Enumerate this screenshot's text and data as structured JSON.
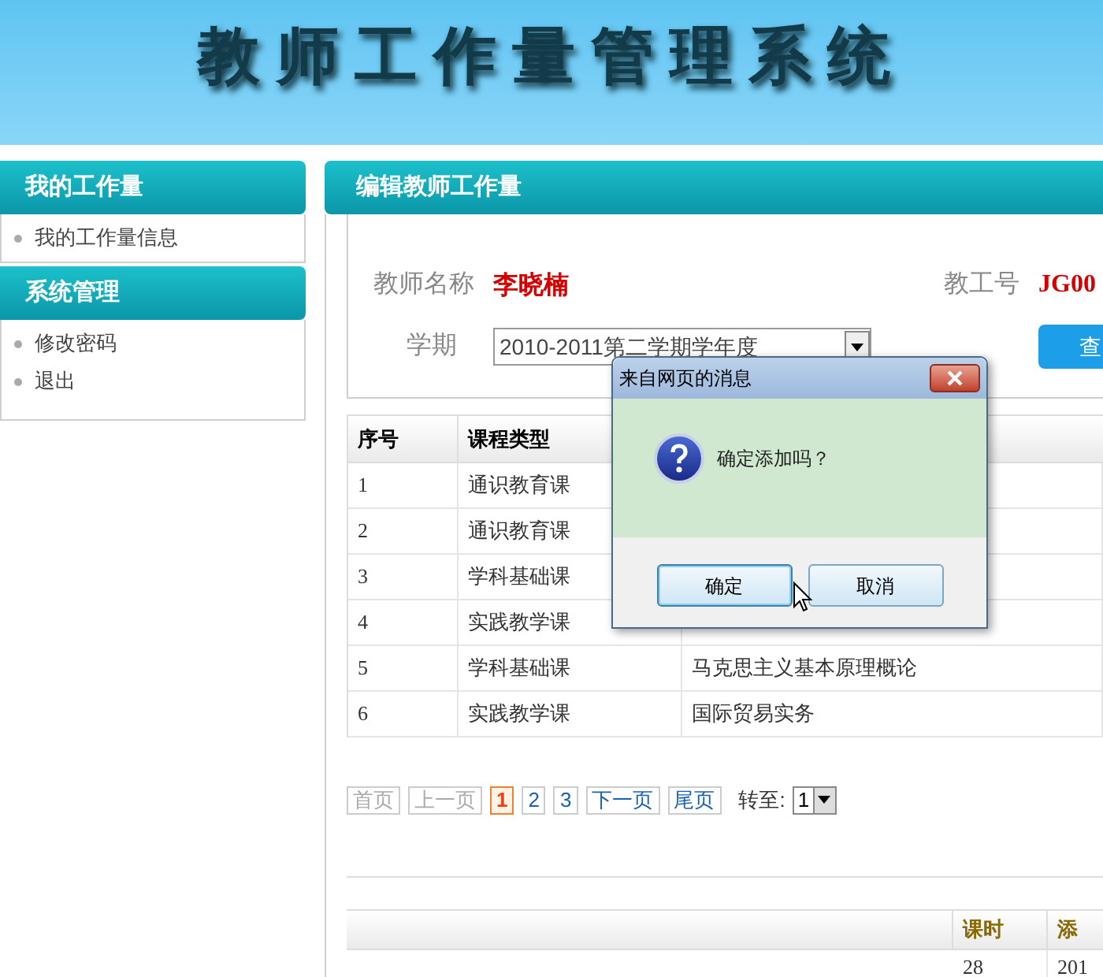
{
  "banner": {
    "title": "教师工作量管理系统"
  },
  "sidebar": [
    {
      "title": "我的工作量",
      "items": [
        {
          "label": "我的工作量信息"
        }
      ]
    },
    {
      "title": "系统管理",
      "items": [
        {
          "label": "修改密码"
        },
        {
          "label": "退出"
        }
      ]
    }
  ],
  "main": {
    "title": "编辑教师工作量",
    "form": {
      "teacher_label": "教师名称",
      "teacher_value": "李晓楠",
      "id_label": "教工号",
      "id_value": "JG00",
      "term_label": "学期",
      "term_value": "2010-2011第二学期学年度",
      "query_button": "查"
    },
    "table": {
      "columns": [
        "序号",
        "课程类型"
      ],
      "rows": [
        [
          "1",
          "通识教育课"
        ],
        [
          "2",
          "通识教育课"
        ],
        [
          "3",
          "学科基础课"
        ],
        [
          "4",
          "实践教学课"
        ],
        [
          "5",
          "学科基础课",
          "马克思主义基本原理概论"
        ],
        [
          "6",
          "实践教学课",
          "国际贸易实务"
        ]
      ]
    },
    "pagination": {
      "pages": [
        {
          "label": "首页",
          "disabled": true,
          "selected": false
        },
        {
          "label": "上一页",
          "disabled": true,
          "selected": false
        },
        {
          "label": "1",
          "disabled": false,
          "selected": true
        },
        {
          "label": "2",
          "disabled": false,
          "selected": false
        },
        {
          "label": "3",
          "disabled": false,
          "selected": false
        },
        {
          "label": "下一页",
          "disabled": false,
          "selected": false
        },
        {
          "label": "尾页",
          "disabled": false,
          "selected": false
        }
      ],
      "goto_label": "转至:",
      "goto_value": "1"
    },
    "table_2": {
      "columns": [
        "课时",
        "添"
      ],
      "rows": [
        [
          "28",
          "201"
        ]
      ]
    }
  },
  "dialog": {
    "title": "来自网页的消息",
    "message": "确定添加吗？",
    "buttons": [
      {
        "label": "确定",
        "focused": true
      },
      {
        "label": "取消",
        "focused": false
      }
    ]
  }
}
